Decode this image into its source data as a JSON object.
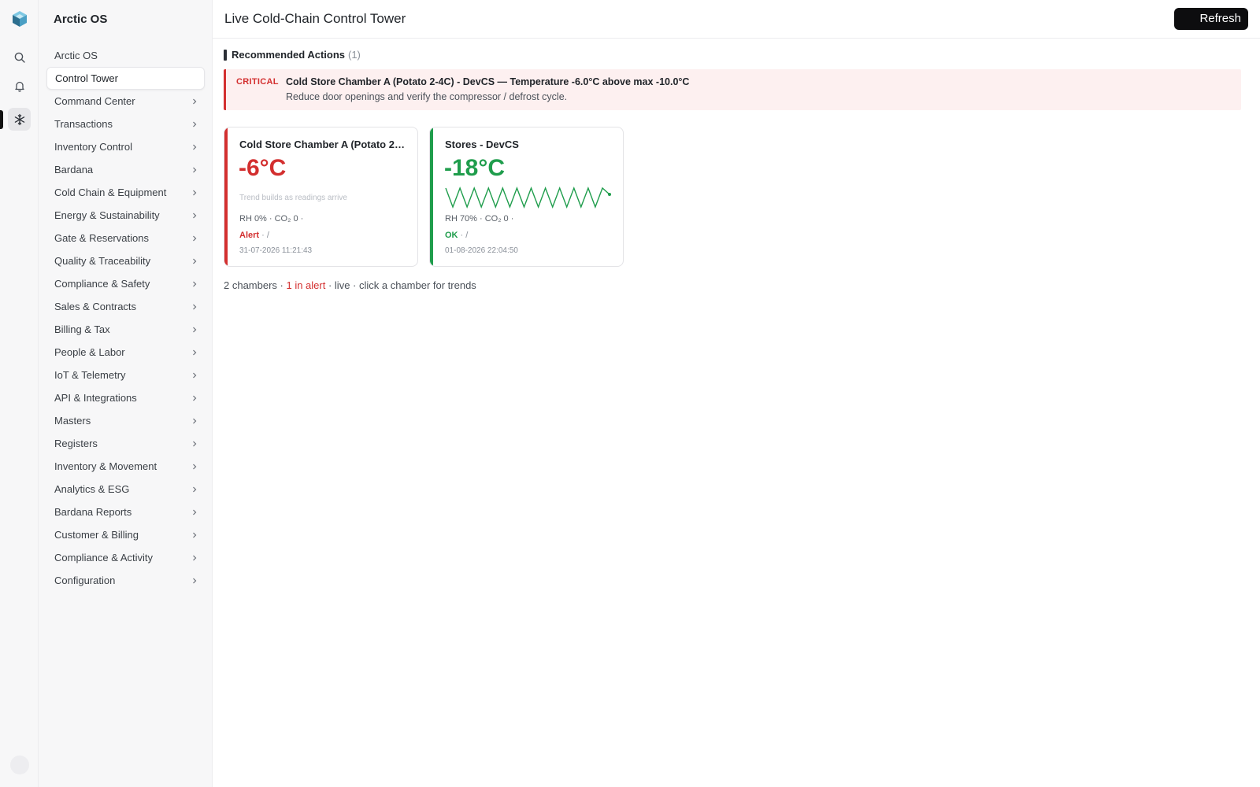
{
  "app": {
    "name": "Arctic OS"
  },
  "rail": {
    "icons": [
      "logo-cube-icon",
      "search-icon",
      "bell-icon",
      "snowflake-icon"
    ]
  },
  "sidebar": {
    "brand": "Arctic OS",
    "items": [
      {
        "label": "Arctic OS",
        "chevron": false
      },
      {
        "label": "Control Tower",
        "chevron": false,
        "active": true
      },
      {
        "label": "Command Center",
        "chevron": true
      },
      {
        "label": "Transactions",
        "chevron": true
      },
      {
        "label": "Inventory Control",
        "chevron": true
      },
      {
        "label": "Bardana",
        "chevron": true
      },
      {
        "label": "Cold Chain & Equipment",
        "chevron": true
      },
      {
        "label": "Energy & Sustainability",
        "chevron": true
      },
      {
        "label": "Gate & Reservations",
        "chevron": true
      },
      {
        "label": "Quality & Traceability",
        "chevron": true
      },
      {
        "label": "Compliance & Safety",
        "chevron": true
      },
      {
        "label": "Sales & Contracts",
        "chevron": true
      },
      {
        "label": "Billing & Tax",
        "chevron": true
      },
      {
        "label": "People & Labor",
        "chevron": true
      },
      {
        "label": "IoT & Telemetry",
        "chevron": true
      },
      {
        "label": "API & Integrations",
        "chevron": true
      },
      {
        "label": "Masters",
        "chevron": true
      },
      {
        "label": "Registers",
        "chevron": true
      },
      {
        "label": "Inventory & Movement",
        "chevron": true
      },
      {
        "label": "Analytics & ESG",
        "chevron": true
      },
      {
        "label": "Bardana Reports",
        "chevron": true
      },
      {
        "label": "Customer & Billing",
        "chevron": true
      },
      {
        "label": "Compliance & Activity",
        "chevron": true
      },
      {
        "label": "Configuration",
        "chevron": true
      }
    ]
  },
  "header": {
    "title": "Live Cold-Chain Control Tower",
    "refresh_label": "Refresh"
  },
  "actions": {
    "heading": "Recommended Actions",
    "count": "(1)",
    "items": [
      {
        "severity": "CRITICAL",
        "title": "Cold Store Chamber A (Potato 2-4C) - DevCS — Temperature -6.0°C above max -10.0°C",
        "description": "Reduce door openings and verify the compressor / defrost cycle."
      }
    ]
  },
  "chambers": [
    {
      "name": "Cold Store Chamber A (Potato 2-4C)",
      "temp": "-6°C",
      "hint": "Trend builds as readings arrive",
      "meta": "RH 0% · CO₂ 0 ·",
      "status": "Alert",
      "status_suffix": " · /",
      "timestamp": "31-07-2026 11:21:43",
      "status_color": "#d32f2f"
    },
    {
      "name": "Stores - DevCS",
      "temp": "-18°C",
      "meta": "RH 70% · CO₂ 0 ·",
      "status": "OK",
      "status_suffix": " · /",
      "timestamp": "01-08-2026 22:04:50",
      "status_color": "#1f9d4c",
      "trend": [
        -17.4,
        -18.6,
        -17.4,
        -18.6,
        -17.4,
        -18.6,
        -17.4,
        -18.6,
        -17.4,
        -18.6,
        -17.4,
        -18.6,
        -17.4,
        -18.6,
        -17.4,
        -18.6,
        -17.4,
        -18.6,
        -17.4,
        -18.6,
        -17.4,
        -18.6,
        -17.4,
        -17.8
      ]
    }
  ],
  "summary": {
    "chambers": "2 chambers ·",
    "alert": " 1 in alert",
    "rest": " · live · click a chamber for trends"
  },
  "colors": {
    "critical": "#d32f2f",
    "ok": "#1f9d4c",
    "accent": "#0d0d0f"
  }
}
